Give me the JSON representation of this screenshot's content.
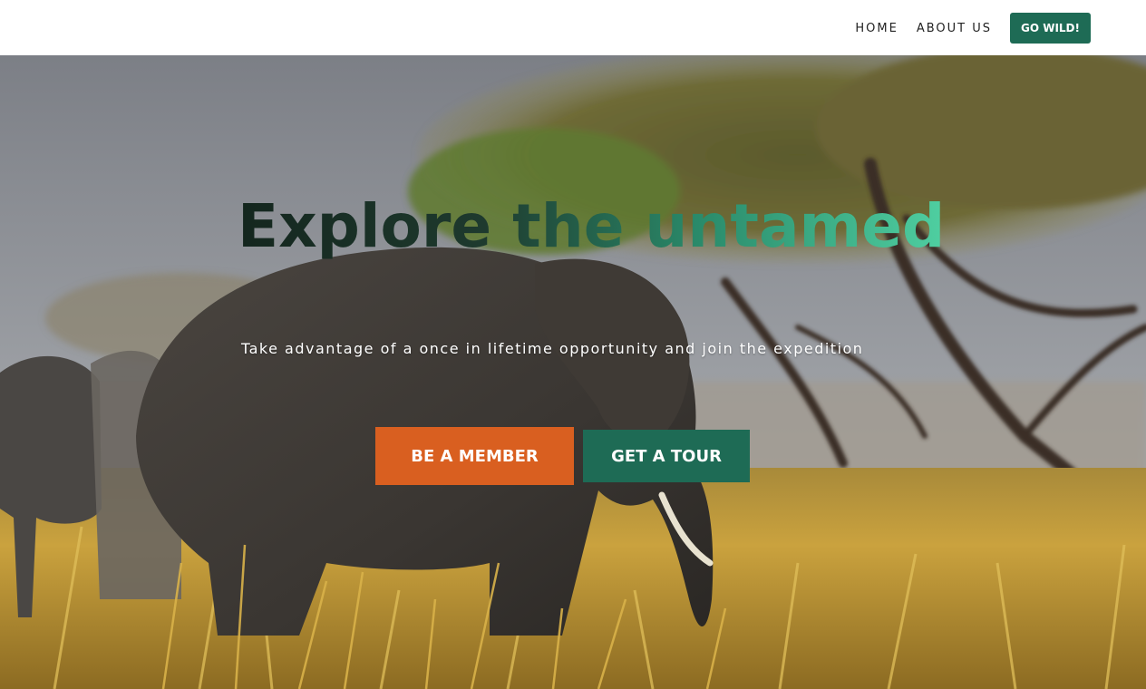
{
  "nav": {
    "home_label": "HOME",
    "about_label": "ABOUT US",
    "cta_label": "GO WILD!"
  },
  "hero": {
    "title": "Explore the untamed",
    "subtitle": "Take advantage of a once in lifetime opportunity and join the expedition",
    "primary_button_label": "BE A MEMBER",
    "secondary_button_label": "GET A TOUR",
    "background_image": "savanna-elephant-photo"
  },
  "colors": {
    "brand_green": "#1e6b55",
    "accent_orange": "#d95f20",
    "title_gradient_start": "#14261e",
    "title_gradient_end": "#4fcfa1"
  }
}
